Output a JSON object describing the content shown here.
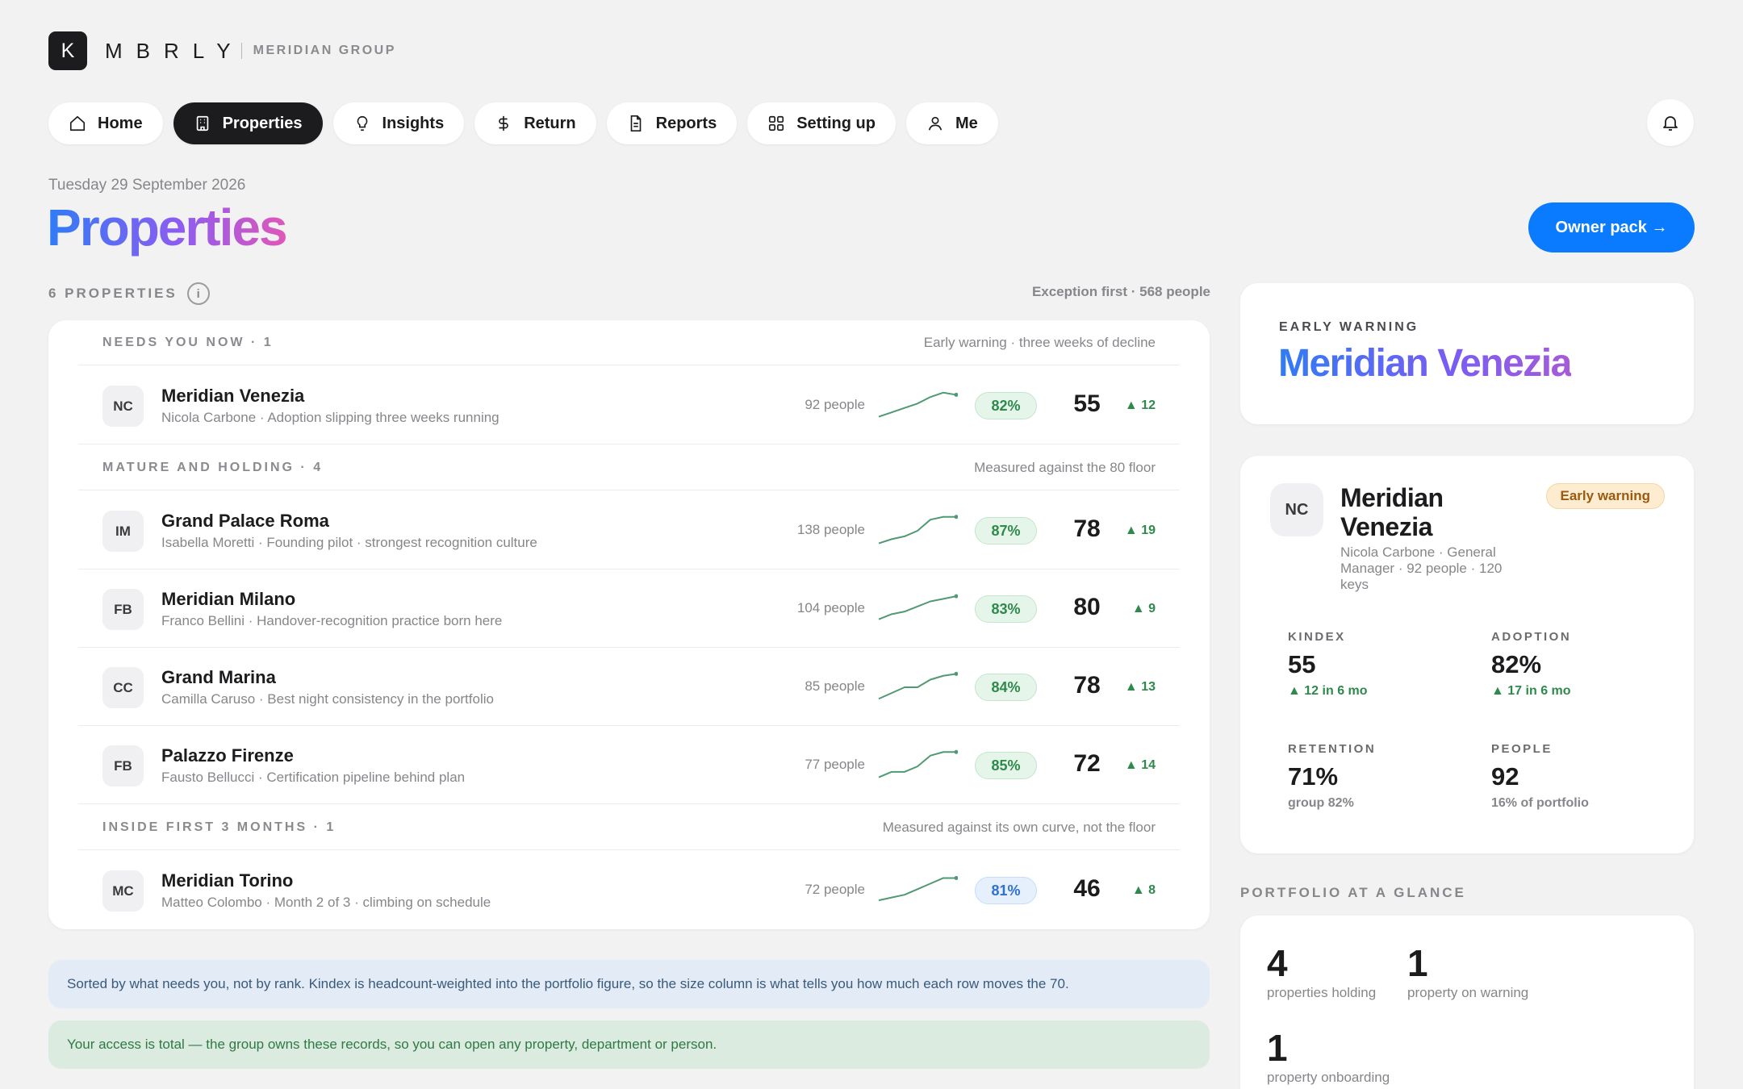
{
  "brand": {
    "logo_letter": "K",
    "wordmark": "MBRLY",
    "group": "MERIDIAN GROUP"
  },
  "nav": [
    {
      "label": "Home",
      "icon": "home-icon",
      "active": false
    },
    {
      "label": "Properties",
      "icon": "building-icon",
      "active": true
    },
    {
      "label": "Insights",
      "icon": "lightbulb-icon",
      "active": false
    },
    {
      "label": "Return",
      "icon": "dollar-icon",
      "active": false
    },
    {
      "label": "Reports",
      "icon": "document-icon",
      "active": false
    },
    {
      "label": "Setting up",
      "icon": "grid-icon",
      "active": false
    },
    {
      "label": "Me",
      "icon": "person-icon",
      "active": false
    }
  ],
  "header": {
    "date": "Tuesday 29 September 2026",
    "title": "Properties",
    "owner_button": "Owner pack →"
  },
  "properties": {
    "count_label": "6 PROPERTIES",
    "info": "i",
    "meta": "Exception first · 568 people"
  },
  "groups": [
    {
      "title": "NEEDS YOU NOW · 1",
      "note": "Early warning · three weeks of decline",
      "rows": [
        {
          "initials": "NC",
          "name": "Meridian Venezia",
          "sub": "Nicola Carbone · Adoption slipping three weeks running",
          "people": "92 people",
          "pct": "82%",
          "pct_style": "green",
          "score": "55",
          "delta": "▲ 12",
          "trend": [
            45,
            47,
            49,
            51,
            54,
            56,
            55
          ]
        }
      ]
    },
    {
      "title": "MATURE AND HOLDING · 4",
      "note": "Measured against the 80 floor",
      "rows": [
        {
          "initials": "IM",
          "name": "Grand Palace Roma",
          "sub": "Isabella Moretti · Founding pilot · strongest recognition culture",
          "people": "138 people",
          "pct": "87%",
          "pct_style": "green",
          "score": "78",
          "delta": "▲ 19",
          "trend": [
            59,
            62,
            64,
            68,
            76,
            78,
            78
          ]
        },
        {
          "initials": "FB",
          "name": "Meridian Milano",
          "sub": "Franco Bellini · Handover-recognition practice born here",
          "people": "104 people",
          "pct": "83%",
          "pct_style": "green",
          "score": "80",
          "delta": "▲ 9",
          "trend": [
            71,
            73,
            74,
            76,
            78,
            79,
            80
          ]
        },
        {
          "initials": "CC",
          "name": "Grand Marina",
          "sub": "Camilla Caruso · Best night consistency in the portfolio",
          "people": "85 people",
          "pct": "84%",
          "pct_style": "green",
          "score": "78",
          "delta": "▲ 13",
          "trend": [
            65,
            68,
            71,
            71,
            75,
            77,
            78
          ]
        },
        {
          "initials": "FB",
          "name": "Palazzo Firenze",
          "sub": "Fausto Bellucci · Certification pipeline behind plan",
          "people": "77 people",
          "pct": "85%",
          "pct_style": "green",
          "score": "72",
          "delta": "▲ 14",
          "trend": [
            58,
            61,
            61,
            64,
            70,
            72,
            72
          ]
        }
      ]
    },
    {
      "title": "INSIDE FIRST 3 MONTHS · 1",
      "note": "Measured against its own curve, not the floor",
      "rows": [
        {
          "initials": "MC",
          "name": "Meridian Torino",
          "sub": "Matteo Colombo · Month 2 of 3 · climbing on schedule",
          "people": "72 people",
          "pct": "81%",
          "pct_style": "blue",
          "score": "46",
          "delta": "▲ 8",
          "trend": [
            38,
            39,
            40,
            42,
            44,
            46,
            46
          ]
        }
      ]
    }
  ],
  "notices": {
    "sort_note": "Sorted by what needs you, not by rank. Kindex is headcount-weighted into the portfolio figure, so the size column is what tells you how much each row moves the 70.",
    "access_note": "Your access is total — the group owns these records, so you can open any property, department or person."
  },
  "early_warning": {
    "label": "EARLY WARNING",
    "title": "Meridian Venezia"
  },
  "detail": {
    "initials": "NC",
    "name": "Meridian Venezia",
    "sub": "Nicola Carbone · General Manager · 92 people · 120 keys",
    "badge": "Early warning",
    "metrics": [
      {
        "label": "KINDEX",
        "value": "55",
        "sub": "▲ 12 in 6 mo",
        "style": "up"
      },
      {
        "label": "ADOPTION",
        "value": "82%",
        "sub": "▲ 17 in 6 mo",
        "style": "up"
      },
      {
        "label": "RETENTION",
        "value": "71%",
        "sub": "group 82%",
        "style": "gray"
      },
      {
        "label": "PEOPLE",
        "value": "92",
        "sub": "16% of portfolio",
        "style": "gray"
      }
    ]
  },
  "glance": {
    "label": "PORTFOLIO AT A GLANCE",
    "stats": [
      {
        "value": "4",
        "label": "properties holding"
      },
      {
        "value": "1",
        "label": "property on warning"
      },
      {
        "value": "1",
        "label": "property onboarding"
      }
    ]
  },
  "colors": {
    "accent": "#0a7aff",
    "positive": "#2e8a4b",
    "warning_bg": "#fdeccf",
    "spark": "#4f9a72"
  }
}
